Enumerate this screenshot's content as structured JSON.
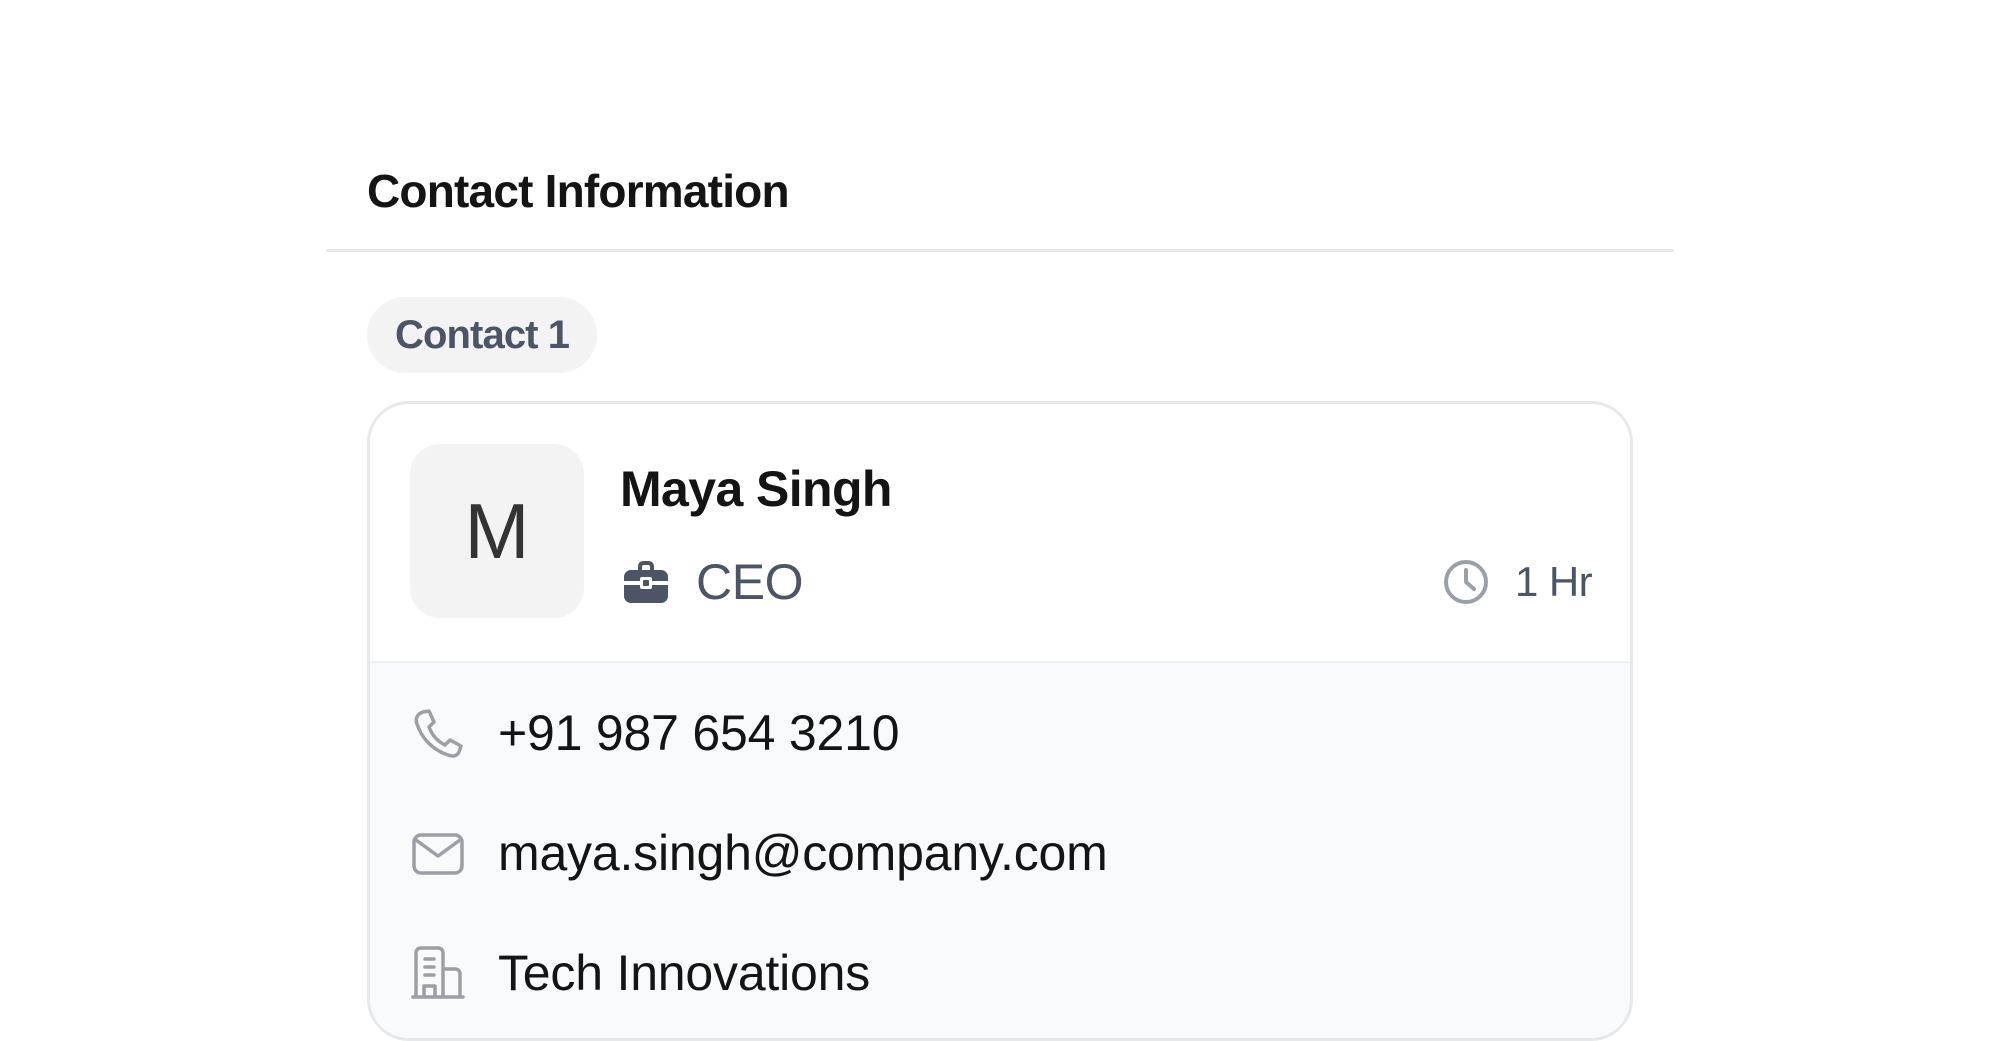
{
  "section": {
    "title": "Contact Information"
  },
  "contact_tab": {
    "label": "Contact 1"
  },
  "contact": {
    "initial": "M",
    "name": "Maya Singh",
    "role": "CEO",
    "time_label": "1 Hr",
    "phone": "+91 987 654 3210",
    "email": "maya.singh@company.com",
    "company": "Tech Innovations"
  },
  "icons": {
    "briefcase": "briefcase-icon",
    "clock": "clock-icon",
    "phone": "phone-icon",
    "email": "mail-icon",
    "company": "building-icon"
  },
  "colors": {
    "title_text": "#141414",
    "muted_text": "#4b5566",
    "badge_background": "#f3f3f4",
    "divider": "#e7e8eb",
    "details_background": "#f9fafb",
    "icon_gray": "#9aa0a6",
    "briefcase": "#4b5566"
  }
}
